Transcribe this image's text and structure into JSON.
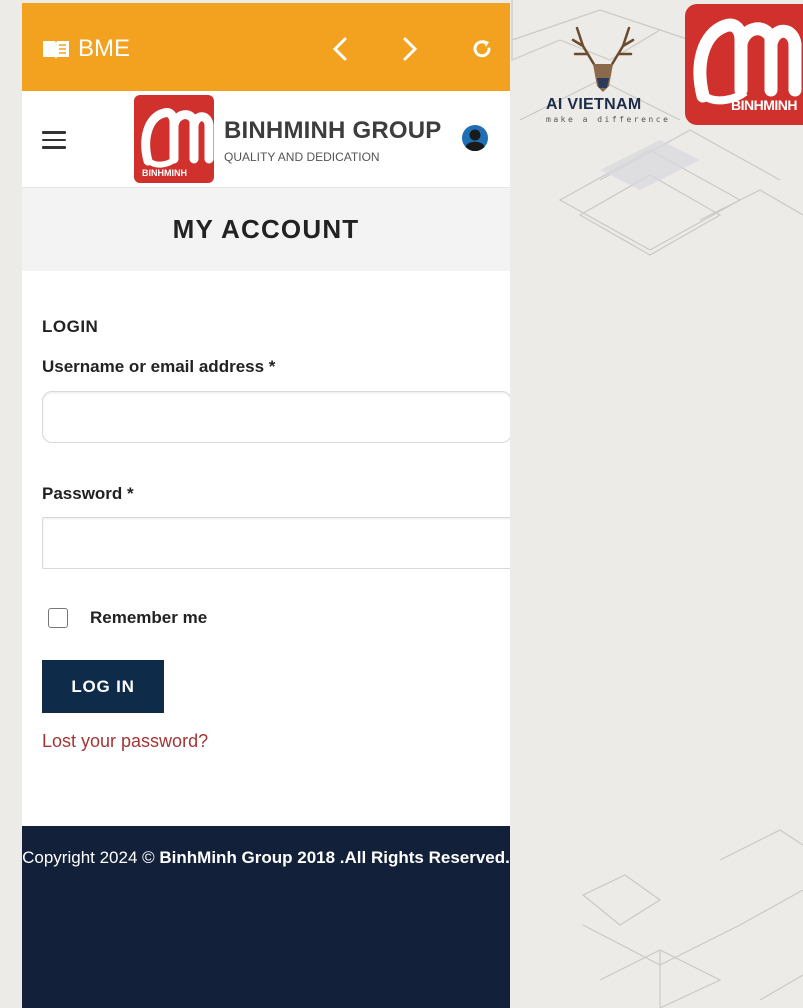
{
  "browser": {
    "app_name": "BME",
    "back_label": "back",
    "forward_label": "forward",
    "reload_label": "reload"
  },
  "brand_corner": {
    "ai_title": "AI VIETNAM",
    "ai_subtitle": "make a difference",
    "binhminh_logo_text": "BINHMINH"
  },
  "header": {
    "brand_name": "BINHMINH GROUP",
    "tagline": "QUALITY AND DEDICATION",
    "logo_mark_text": "BINHMINH"
  },
  "page": {
    "title": "MY ACCOUNT"
  },
  "login": {
    "heading": "LOGIN",
    "username_label": "Username or email address *",
    "username_value": "",
    "password_label": "Password *",
    "password_value": "",
    "remember_label": "Remember me",
    "remember_checked": false,
    "submit_label": "LOG IN",
    "lost_password": "Lost your password?"
  },
  "footer": {
    "copyright_prefix": "Copyright 2024 © ",
    "copyright_bold": "BinhMinh Group 2018 .All Rights Reserved."
  },
  "colors": {
    "browser_bar": "#f2a21e",
    "brand_red": "#d0312d",
    "button_navy": "#0e2b4a",
    "footer_navy": "#13203a",
    "link_red": "#a33535"
  }
}
